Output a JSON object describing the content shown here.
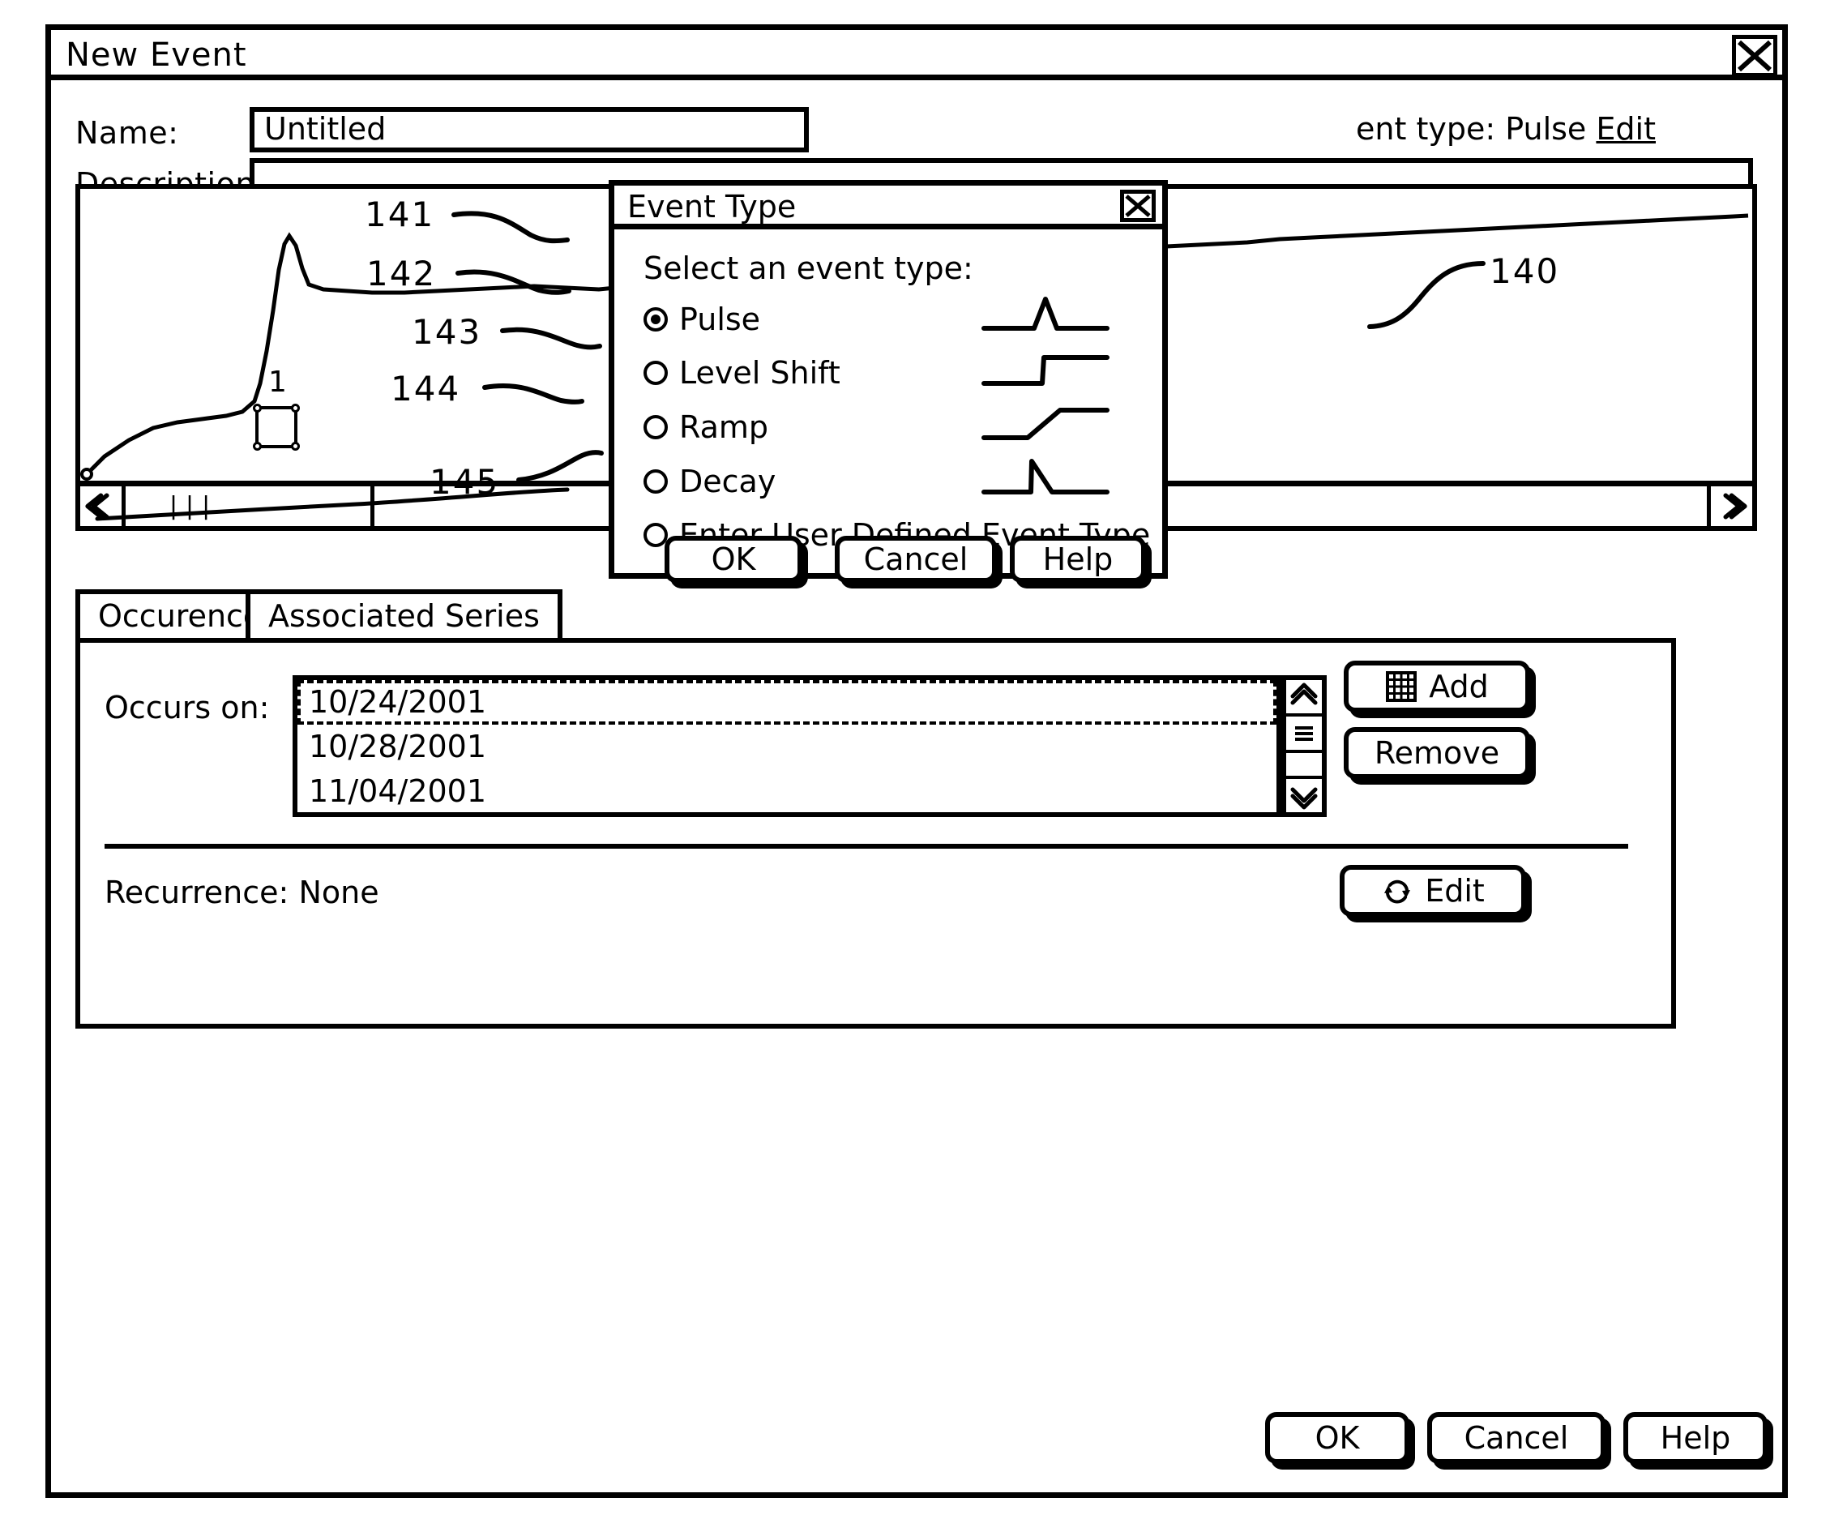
{
  "window": {
    "title": "New Event",
    "close_icon": "close-x-icon"
  },
  "form": {
    "name_label": "Name:",
    "name_value": "Untitled",
    "description_label": "Description:",
    "description_value": "",
    "event_type_prefix": "ent type:",
    "event_type_value": "Pulse",
    "event_type_edit": "Edit"
  },
  "chart": {
    "selection_label": "1",
    "hscroll": {
      "left_icon": "chevron-double-left-icon",
      "right_icon": "chevron-double-right-icon",
      "grip": "|||"
    }
  },
  "tabs": [
    {
      "label": "Occurence",
      "active": true
    },
    {
      "label": "Associated Series",
      "active": false
    }
  ],
  "occurrence": {
    "occurs_on_label": "Occurs on:",
    "dates": [
      "10/24/2001",
      "10/28/2001",
      "11/04/2001"
    ],
    "selected_index": 0,
    "add_label": "Add",
    "add_icon": "calendar-grid-icon",
    "remove_label": "Remove",
    "recurrence_label": "Recurrence:",
    "recurrence_value": "None",
    "recurrence_edit_label": "Edit",
    "recurrence_edit_icon": "recurrence-refresh-icon",
    "scroll_up_icon": "chevron-double-up-icon",
    "scroll_down_icon": "chevron-double-down-icon",
    "scroll_thumb_icon": "grip-lines-icon"
  },
  "main_buttons": {
    "ok": "OK",
    "cancel": "Cancel",
    "help": "Help"
  },
  "event_dialog": {
    "title": "Event Type",
    "close_icon": "close-x-icon",
    "prompt": "Select an event type:",
    "options": [
      {
        "label": "Pulse",
        "selected": true,
        "glyph": "pulse-waveform-icon"
      },
      {
        "label": "Level Shift",
        "selected": false,
        "glyph": "level-shift-waveform-icon"
      },
      {
        "label": "Ramp",
        "selected": false,
        "glyph": "ramp-waveform-icon"
      },
      {
        "label": "Decay",
        "selected": false,
        "glyph": "decay-waveform-icon"
      },
      {
        "label": "Enter User Defined Event Type",
        "selected": false,
        "glyph": ""
      }
    ],
    "ok": "OK",
    "cancel": "Cancel",
    "help": "Help"
  },
  "reference_numerals": {
    "n140": "140",
    "n141": "141",
    "n142": "142",
    "n143": "143",
    "n144": "144",
    "n145": "145"
  },
  "colors": {
    "ink": "#000000",
    "paper": "#ffffff"
  }
}
